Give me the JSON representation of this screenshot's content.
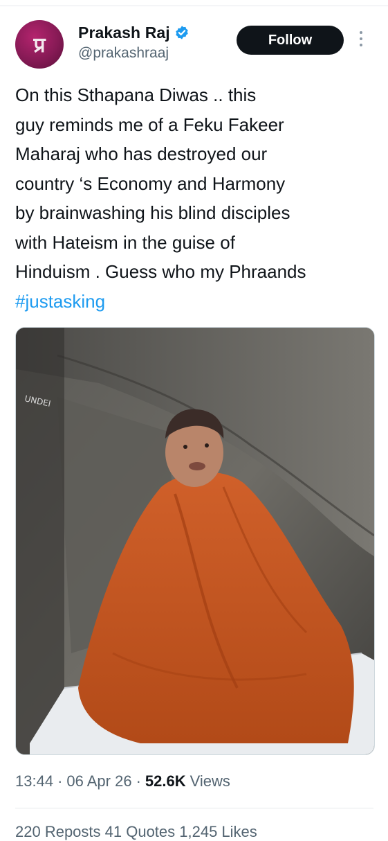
{
  "author": {
    "name": "Prakash Raj",
    "handle": "@prakashraaj",
    "avatar_icon": "prakash-raj-logo-icon",
    "avatar_logo_text": "प्र",
    "verified_icon": "verified-badge-icon",
    "follow_label": "Follow",
    "more_icon": "more-options-icon"
  },
  "tweet": {
    "lines": [
      "On this Sthapana Diwas .. this",
      "guy reminds me of a Feku Fakeer",
      "Maharaj who has destroyed our",
      "country ‘s Economy and Harmony",
      "by brainwashing his blind disciples",
      "with Hateism in the guise of",
      "Hinduism . Guess who my Phraands"
    ],
    "hashtag": "#justasking"
  },
  "media": {
    "image_icon": "tweet-photo",
    "watermark_text": "UNDEI"
  },
  "meta": {
    "time": "13:44",
    "date": "06 Apr 26",
    "views_count": "52.6K",
    "views_label": "Views",
    "separator": "·"
  },
  "cutoff_row": "220 Reposts   41 Quotes   1,245 Likes",
  "colors": {
    "accent": "#1d9bf0",
    "follow_bg": "#0f1419",
    "secondary_text": "#536471",
    "robe": "#c8561f"
  }
}
